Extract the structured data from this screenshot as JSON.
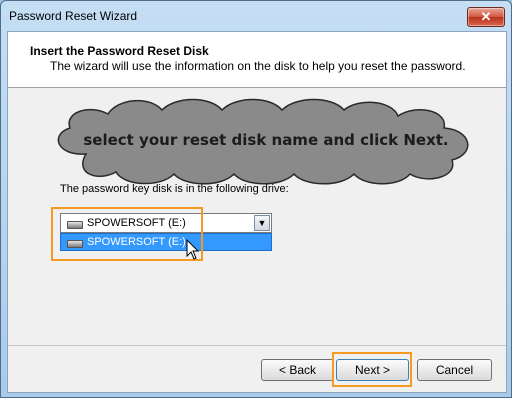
{
  "window": {
    "title": "Password Reset Wizard",
    "close_glyph": "✕"
  },
  "header": {
    "title": "Insert the Password Reset Disk",
    "subtitle": "The wizard will use the information on the disk to help you reset the password."
  },
  "annotation": {
    "text": "select your reset disk name and click Next."
  },
  "drive": {
    "label": "The password key disk is in the following drive:",
    "selected": "SPOWERSOFT (E:)",
    "options": [
      "SPOWERSOFT (E:)"
    ]
  },
  "buttons": {
    "back": "< Back",
    "next": "Next >",
    "cancel": "Cancel"
  },
  "colors": {
    "highlight": "#f59a23",
    "selection": "#3399ff"
  },
  "icons": {
    "dropdown": "▼"
  }
}
